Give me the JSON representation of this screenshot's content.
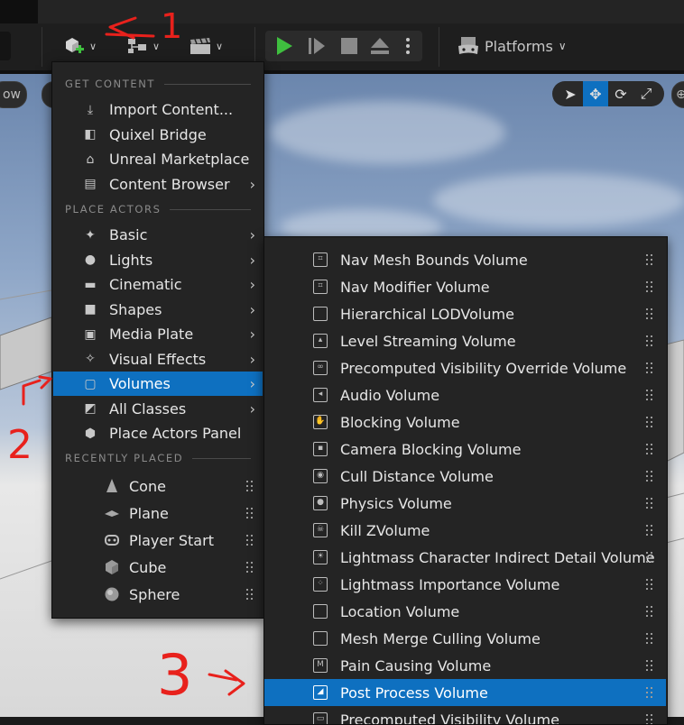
{
  "toolbar": {
    "platforms_label": "Platforms",
    "viewport_left_pill": "ow",
    "icons": [
      "add-content-icon",
      "blueprint-icon",
      "cinematics-icon",
      "play-icon",
      "advance-frame-icon",
      "stop-icon",
      "eject-icon",
      "more-options-icon",
      "platforms-icon"
    ]
  },
  "menu": {
    "sections": {
      "get_content": "GET CONTENT",
      "place_actors": "PLACE ACTORS",
      "recently_placed": "RECENTLY PLACED"
    },
    "get_content_items": [
      {
        "label": "Import Content...",
        "icon": "import-icon",
        "submenu": false
      },
      {
        "label": "Quixel Bridge",
        "icon": "bridge-icon",
        "submenu": false
      },
      {
        "label": "Unreal Marketplace",
        "icon": "marketplace-icon",
        "submenu": false
      },
      {
        "label": "Content Browser",
        "icon": "content-browser-icon",
        "submenu": true
      }
    ],
    "place_actors_items": [
      {
        "label": "Basic",
        "icon": "basic-icon",
        "submenu": true
      },
      {
        "label": "Lights",
        "icon": "light-bulb-icon",
        "submenu": true
      },
      {
        "label": "Cinematic",
        "icon": "clapper-icon",
        "submenu": true
      },
      {
        "label": "Shapes",
        "icon": "cube-icon",
        "submenu": true
      },
      {
        "label": "Media Plate",
        "icon": "media-plate-icon",
        "submenu": true
      },
      {
        "label": "Visual Effects",
        "icon": "sparkle-icon",
        "submenu": true
      },
      {
        "label": "Volumes",
        "icon": "volume-icon",
        "submenu": true,
        "active": true
      },
      {
        "label": "All Classes",
        "icon": "classes-icon",
        "submenu": true
      },
      {
        "label": "Place Actors Panel",
        "icon": "place-actors-icon",
        "submenu": false
      }
    ],
    "recent_items": [
      {
        "label": "Cone",
        "icon": "cone-icon"
      },
      {
        "label": "Plane",
        "icon": "plane-icon"
      },
      {
        "label": "Player Start",
        "icon": "player-start-icon"
      },
      {
        "label": "Cube",
        "icon": "cube-icon"
      },
      {
        "label": "Sphere",
        "icon": "sphere-icon"
      }
    ]
  },
  "volumes_menu": {
    "items": [
      {
        "label": "Nav Mesh Bounds Volume",
        "icon": "nav-mesh-icon"
      },
      {
        "label": "Nav Modifier Volume",
        "icon": "nav-modifier-icon"
      },
      {
        "label": "Hierarchical LODVolume",
        "icon": "lod-volume-icon"
      },
      {
        "label": "Level Streaming Volume",
        "icon": "level-streaming-icon"
      },
      {
        "label": "Precomputed Visibility Override Volume",
        "icon": "visibility-override-icon"
      },
      {
        "label": "Audio Volume",
        "icon": "audio-icon"
      },
      {
        "label": "Blocking Volume",
        "icon": "blocking-hand-icon"
      },
      {
        "label": "Camera Blocking Volume",
        "icon": "camera-blocking-icon"
      },
      {
        "label": "Cull Distance Volume",
        "icon": "eye-icon"
      },
      {
        "label": "Physics Volume",
        "icon": "physics-icon"
      },
      {
        "label": "Kill ZVolume",
        "icon": "skull-icon"
      },
      {
        "label": "Lightmass Character Indirect Detail Volume",
        "icon": "sun-icon"
      },
      {
        "label": "Lightmass Importance Volume",
        "icon": "lightmass-importance-icon"
      },
      {
        "label": "Location Volume",
        "icon": "location-volume-icon"
      },
      {
        "label": "Mesh Merge Culling Volume",
        "icon": "mesh-merge-icon"
      },
      {
        "label": "Pain Causing Volume",
        "icon": "pain-icon"
      },
      {
        "label": "Post Process Volume",
        "icon": "post-process-icon",
        "active": true
      },
      {
        "label": "Precomputed Visibility Volume",
        "icon": "visibility-icon"
      }
    ]
  },
  "annotations": {
    "color": "#e8211c",
    "numbers": [
      "1",
      "2",
      "3"
    ]
  },
  "colors": {
    "accent": "#0e70c0",
    "play_green": "#3fbf3f",
    "menu_bg": "#242424"
  }
}
